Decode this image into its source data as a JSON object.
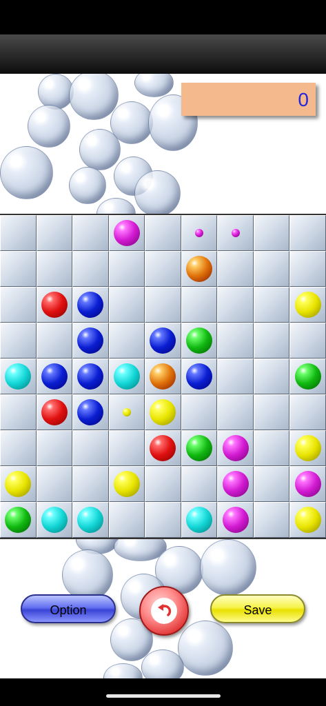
{
  "score": "0",
  "buttons": {
    "option": "Option",
    "save": "Save",
    "undo_icon": "undo-arrow"
  },
  "colors": {
    "magenta": "#d21bd2",
    "orange": "#e0720a",
    "red": "#e01010",
    "blue": "#0a1ed2",
    "yellow": "#e8e400",
    "green": "#11b811",
    "cyan": "#14d6d6",
    "score_bg": "#f5b98e",
    "score_text": "#2727d9"
  },
  "board": [
    [
      "",
      "",
      "",
      "magenta",
      "",
      "magenta_s",
      "magenta_s",
      "",
      ""
    ],
    [
      "",
      "",
      "",
      "",
      "",
      "orange",
      "",
      "",
      ""
    ],
    [
      "",
      "red",
      "blue",
      "",
      "",
      "",
      "",
      "",
      "yellow"
    ],
    [
      "",
      "",
      "blue",
      "",
      "blue",
      "green",
      "",
      "",
      ""
    ],
    [
      "cyan",
      "blue",
      "blue",
      "cyan",
      "orange",
      "blue",
      "",
      "",
      "green"
    ],
    [
      "",
      "red",
      "blue",
      "yellow_s",
      "yellow",
      "",
      "",
      "",
      ""
    ],
    [
      "",
      "",
      "",
      "",
      "red",
      "green",
      "magenta",
      "",
      "yellow"
    ],
    [
      "yellow",
      "",
      "",
      "yellow",
      "",
      "",
      "magenta",
      "",
      "magenta"
    ],
    [
      "green",
      "cyan",
      "cyan",
      "",
      "",
      "cyan",
      "magenta",
      "",
      "yellow"
    ]
  ]
}
